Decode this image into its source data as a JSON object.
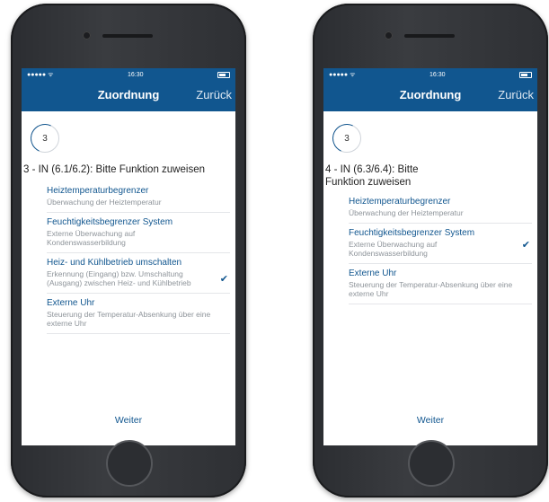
{
  "status": {
    "time": "16:30",
    "signal": "●●●●● ᯤ"
  },
  "screens": [
    {
      "nav_title": "Zuordnung",
      "back_label": "Zurück",
      "step": "3",
      "heading": "3 - IN (6.1/6.2): Bitte Funktion zuweisen",
      "items": [
        {
          "title": "Heiztemperaturbegrenzer",
          "desc": "Überwachung der Heiztemperatur",
          "checked": false
        },
        {
          "title": "Feuchtigkeitsbegrenzer System",
          "desc": "Externe Überwachung auf Kondenswasserbildung",
          "checked": false
        },
        {
          "title": "Heiz- und Kühlbetrieb umschalten",
          "desc": "Erkennung (Eingang) bzw. Umschaltung (Ausgang) zwischen Heiz- und Kühlbetrieb",
          "checked": true
        },
        {
          "title": "Externe Uhr",
          "desc": "Steuerung der Temperatur-Absenkung über eine externe Uhr",
          "checked": false
        }
      ],
      "next_label": "Weiter"
    },
    {
      "nav_title": "Zuordnung",
      "back_label": "Zurück",
      "step": "3",
      "heading": "4 - IN (6.3/6.4): Bitte Funktion zuweisen",
      "items": [
        {
          "title": "Heiztemperaturbegrenzer",
          "desc": "Überwachung der Heiztemperatur",
          "checked": false
        },
        {
          "title": "Feuchtigkeitsbegrenzer System",
          "desc": "Externe Überwachung auf Kondenswasserbildung",
          "checked": true
        },
        {
          "title": "Externe Uhr",
          "desc": "Steuerung der Temperatur-Absenkung über eine externe Uhr",
          "checked": false
        }
      ],
      "next_label": "Weiter"
    }
  ],
  "colors": {
    "brand": "#11568f",
    "secondary_text": "#8e949a",
    "divider": "#e4e6e9"
  },
  "icons": {
    "checkmark": "checkmark-icon",
    "battery": "battery-icon",
    "signal": "signal-icon"
  }
}
